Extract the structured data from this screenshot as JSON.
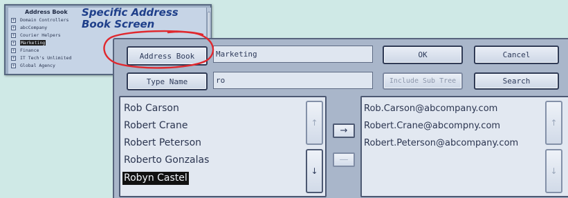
{
  "tree_panel": {
    "title": "Address Book",
    "items": [
      {
        "icon": "expand-box-icon",
        "label": "Domain Controllers",
        "selected": false
      },
      {
        "icon": "expand-box-icon",
        "label": "abcCompany",
        "selected": false
      },
      {
        "icon": "expand-box-icon",
        "label": "Courier Helpers",
        "selected": false
      },
      {
        "icon": "expand-box-icon",
        "label": "Marketing",
        "selected": true
      },
      {
        "icon": "expand-box-icon",
        "label": "Finance",
        "selected": false
      },
      {
        "icon": "expand-box-icon",
        "label": "IT Tech's Unlimited",
        "selected": false
      },
      {
        "icon": "expand-box-icon",
        "label": "Global Agency",
        "selected": false
      }
    ]
  },
  "caption": {
    "line1": "Specific Address",
    "line2": "Book Screen"
  },
  "main": {
    "address_book_button": "Address Book",
    "address_book_value": "Marketing",
    "ok_button": "OK",
    "cancel_button": "Cancel",
    "type_name_button": "Type Name",
    "type_name_value": "ro",
    "include_sub_tree_button": "Include Sub Tree",
    "search_button": "Search",
    "names": [
      {
        "label": "Rob Carson",
        "selected": false
      },
      {
        "label": "Robert Crane",
        "selected": false
      },
      {
        "label": "Robert Peterson",
        "selected": false
      },
      {
        "label": "Roberto Gonzalas",
        "selected": false
      },
      {
        "label": "Robyn Castel",
        "selected": true
      }
    ],
    "emails": [
      "Rob.Carson@abcompany.com",
      "Robert.Crane@abcompny.com",
      "Robert.Peterson@abcompany.com"
    ],
    "add_arrow": "→",
    "remove_arrow": "—",
    "scroll_up_glyph": "↑",
    "scroll_down_glyph": "↓"
  },
  "colors": {
    "background": "#cfe9e6",
    "highlight_ring": "#e0282e",
    "caption": "#1e3f8a"
  }
}
